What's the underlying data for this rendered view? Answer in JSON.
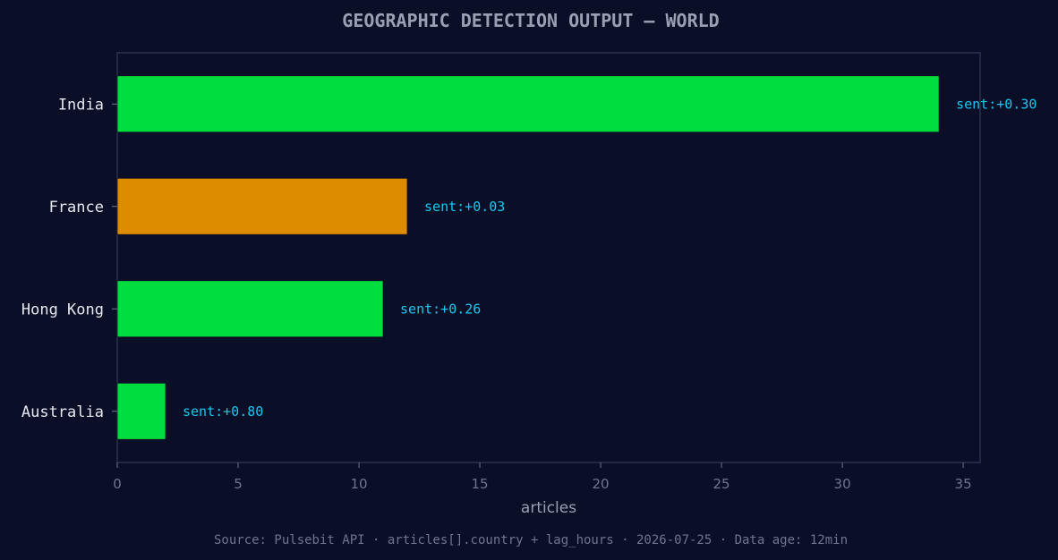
{
  "chart_data": {
    "type": "bar",
    "orientation": "horizontal",
    "title": "GEOGRAPHIC DETECTION OUTPUT — WORLD",
    "xlabel": "articles",
    "ylabel": "",
    "xlim": [
      0,
      35.7
    ],
    "xticks": [
      0,
      5,
      10,
      15,
      20,
      25,
      30,
      35
    ],
    "grid": false,
    "categories": [
      "India",
      "France",
      "Hong Kong",
      "Australia"
    ],
    "values": [
      34,
      12,
      11,
      2
    ],
    "data_labels": [
      "sent:+0.30",
      "sent:+0.03",
      "sent:+0.26",
      "sent:+0.80"
    ],
    "bar_colors": [
      "#00dd3e",
      "#dd8c00",
      "#00dd3e",
      "#00dd3e"
    ],
    "footer": "Source: Pulsebit API · articles[].country + lag_hours · 2026-07-25 · Data age: 12min"
  },
  "colors": {
    "background": "#0a0e27",
    "axis_frame": "#2c3150",
    "positive": "#00dd3e",
    "neutral": "#dd8c00",
    "label_accent": "#18c8f0"
  }
}
